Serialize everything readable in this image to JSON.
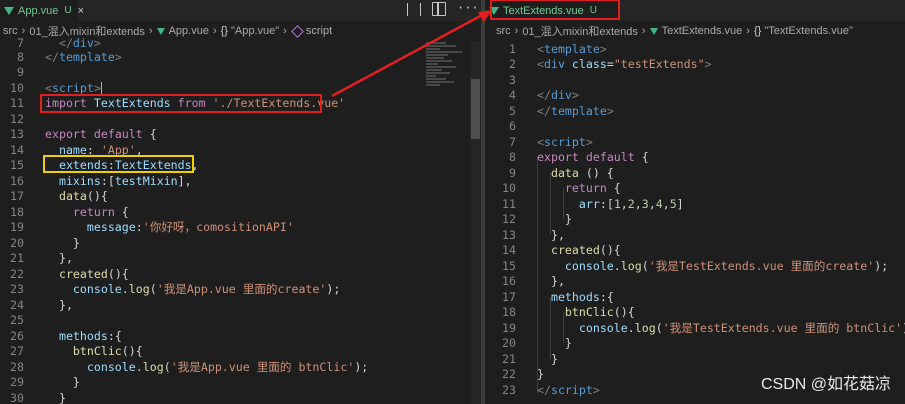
{
  "left": {
    "tab": {
      "name": "App.vue",
      "state": "U"
    },
    "breadcrumb": [
      "src",
      "01_混入mixin和extends",
      "App.vue",
      "\"App.vue\"",
      "script"
    ]
  },
  "right": {
    "tab": {
      "name": "TextExtends.vue",
      "state": "U"
    },
    "breadcrumb": [
      "src",
      "01_混入mixin和extends",
      "TextExtends.vue",
      "\"TextExtends.vue\""
    ]
  },
  "watermark": "CSDN @如花菇凉",
  "colors": {
    "annotation_red": "#e02020",
    "annotation_yellow": "#f0d000",
    "vue_green": "#41b883"
  },
  "icons": {
    "toolbar": [
      "compare-changes-icon",
      "split-editor-icon",
      "more-actions-icon"
    ]
  }
}
